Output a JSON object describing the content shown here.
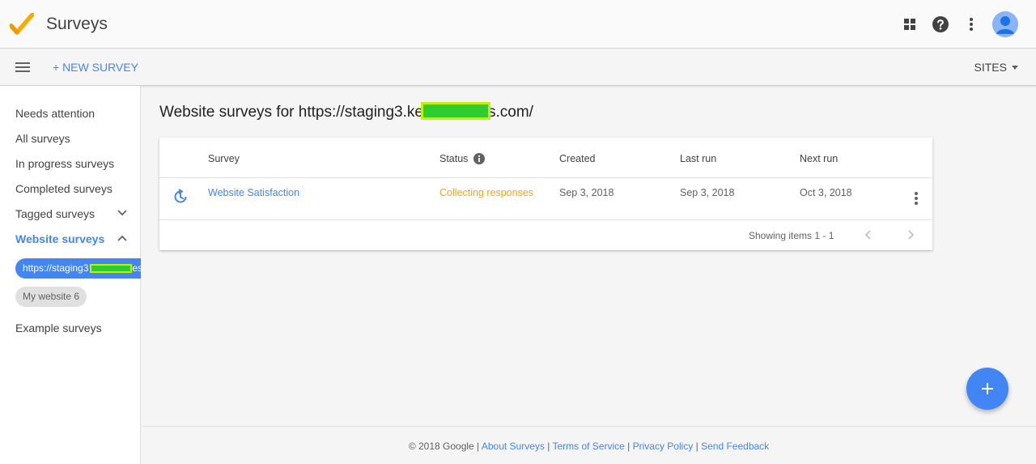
{
  "app": {
    "title": "Surveys"
  },
  "toolbar": {
    "new_survey": "+ NEW SURVEY",
    "sites": "SITES"
  },
  "sidebar": {
    "items": [
      {
        "label": "Needs attention"
      },
      {
        "label": "All surveys"
      },
      {
        "label": "In progress surveys"
      },
      {
        "label": "Completed surveys"
      },
      {
        "label": "Tagged surveys"
      },
      {
        "label": "Website surveys"
      },
      {
        "label": "Example surveys"
      }
    ],
    "sites": [
      {
        "label_prefix": "https://staging3",
        "label_suffix": "es"
      },
      {
        "label": "My website 6"
      }
    ]
  },
  "main": {
    "title_prefix": "Website surveys for https://staging3.ke",
    "title_suffix": "s.com/",
    "columns": [
      "Survey",
      "Status",
      "Created",
      "Last run",
      "Next run"
    ],
    "rows": [
      {
        "survey": "Website Satisfaction",
        "status": "Collecting responses",
        "created": "Sep 3, 2018",
        "last_run": "Sep 3, 2018",
        "next_run": "Oct 3, 2018"
      }
    ],
    "showing": "Showing items 1 - 1"
  },
  "footer": {
    "copyright": "© 2018 Google",
    "links": [
      "About Surveys",
      "Terms of Service",
      "Privacy Policy",
      "Send Feedback"
    ],
    "separator": " | "
  },
  "colors": {
    "accent": "#4285f4",
    "status_in_progress": "#f4a31a",
    "logo": "#f9ab00"
  },
  "icons": [
    "check-logo-icon",
    "apps-grid-icon",
    "help-icon",
    "more-vert-icon",
    "account-icon",
    "menu-icon",
    "chevron-down-icon",
    "chevron-up-icon",
    "info-icon",
    "in-progress-icon",
    "chevron-left-icon",
    "chevron-right-icon",
    "add-icon"
  ]
}
